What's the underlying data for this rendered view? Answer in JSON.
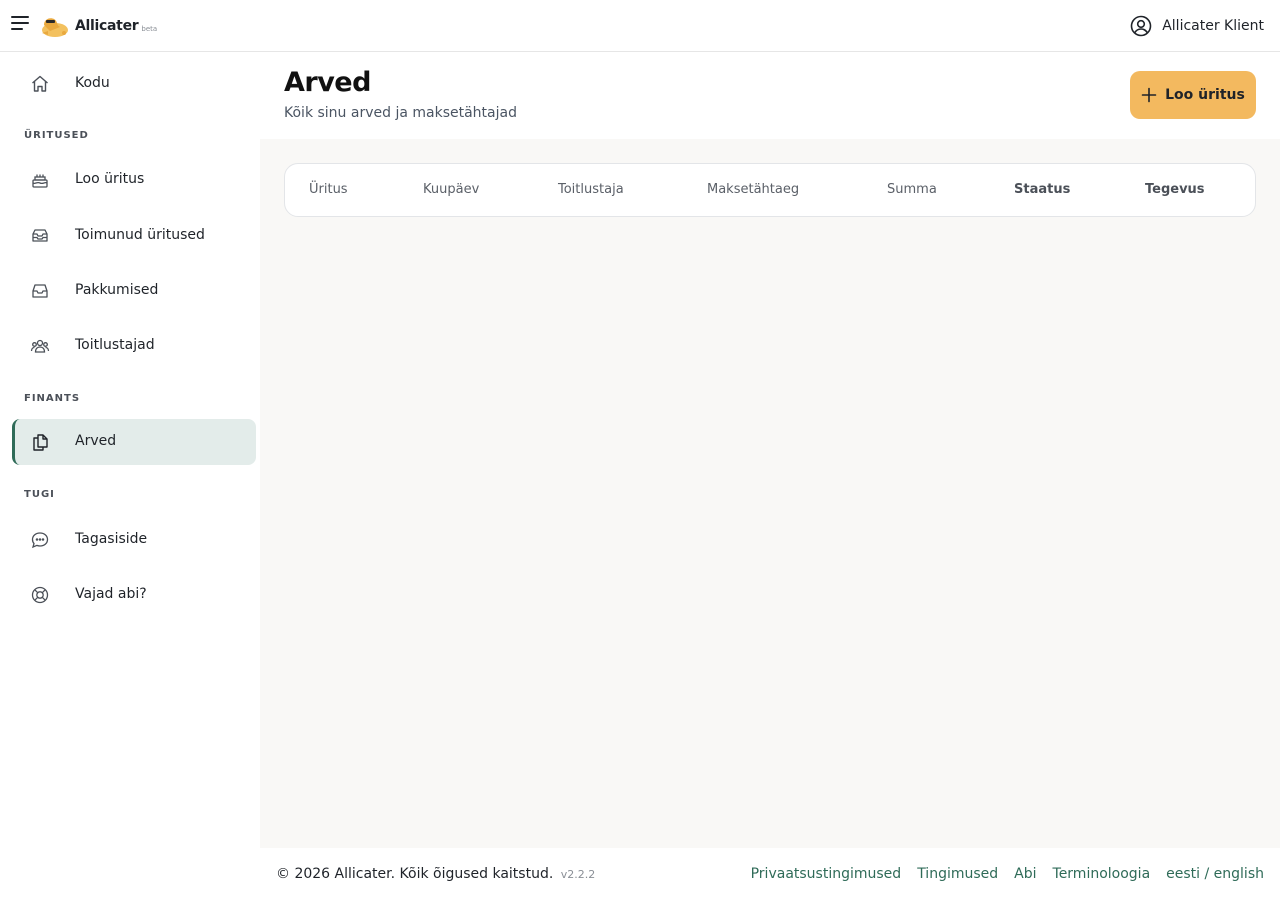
{
  "app": {
    "name": "Allicater",
    "badge": "beta",
    "user_name": "Allicater Klient"
  },
  "sidebar": {
    "home": "Kodu",
    "sections": {
      "events": "ÜRITUSED",
      "finance": "FINANTS",
      "support": "TUGI"
    },
    "items": {
      "create_event": "Loo üritus",
      "past_events": "Toimunud üritused",
      "offers": "Pakkumised",
      "caterers": "Toitlustajad",
      "invoices": "Arved",
      "feedback": "Tagasiside",
      "help": "Vajad abi?"
    },
    "active": "Arved"
  },
  "header": {
    "title": "Arved",
    "subtitle": "Kõik sinu arved ja maksetähtajad",
    "create_button": "Loo üritus"
  },
  "table": {
    "columns": [
      "Üritus",
      "Kuupäev",
      "Toitlustaja",
      "Maksetähtaeg",
      "Summa",
      "Staatus",
      "Tegevus"
    ],
    "rows": []
  },
  "footer": {
    "copyright": "© 2026 Allicater. Kõik õigused kaitstud.",
    "version": "v2.2.2",
    "links": [
      "Privaatsustingimused",
      "Tingimused",
      "Abi",
      "Terminoloogia",
      "eesti / english"
    ]
  },
  "colors": {
    "accent": "#f3b95f",
    "brand_green": "#2f6b58",
    "active_bg": "#e3ecea",
    "content_bg": "#f9f8f6"
  },
  "icons": [
    "menu-icon",
    "logo-dino-icon",
    "user-circle-icon",
    "home-icon",
    "cake-icon",
    "inbox-stack-icon",
    "inbox-icon",
    "users-group-icon",
    "documents-icon",
    "chat-bubble-icon",
    "lifebuoy-icon",
    "plus-icon"
  ]
}
